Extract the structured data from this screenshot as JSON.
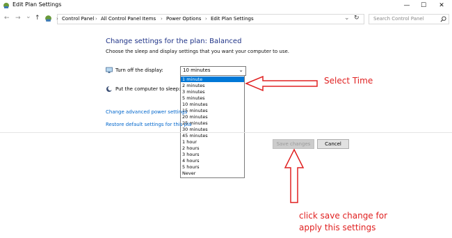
{
  "window": {
    "title": "Edit Plan Settings",
    "minimize_glyph": "—",
    "maximize_glyph": "☐",
    "close_glyph": "✕"
  },
  "nav": {
    "back_glyph": "←",
    "forward_glyph": "→",
    "recent_glyph": "⌄",
    "up_glyph": "↑",
    "refresh_glyph": "↻",
    "history_glyph": "⌄"
  },
  "breadcrumb": {
    "separator": "›",
    "items": [
      "Control Panel",
      "All Control Panel Items",
      "Power Options",
      "Edit Plan Settings"
    ]
  },
  "search": {
    "placeholder": "Search Control Panel",
    "icon": "search-icon"
  },
  "main": {
    "title": "Change settings for the plan: Balanced",
    "subtitle": "Choose the sleep and display settings that you want your computer to use.",
    "display_label": "Turn off the display:",
    "sleep_label": "Put the computer to sleep:",
    "display_value": "10 minutes",
    "options": [
      "1 minute",
      "2 minutes",
      "3 minutes",
      "5 minutes",
      "10 minutes",
      "15 minutes",
      "20 minutes",
      "25 minutes",
      "30 minutes",
      "45 minutes",
      "1 hour",
      "2 hours",
      "3 hours",
      "4 hours",
      "5 hours",
      "Never"
    ],
    "selected_option": "1 minute",
    "advanced_link": "Change advanced power settings",
    "restore_link": "Restore default settings for this pla",
    "save_button": "Save changes",
    "cancel_button": "Cancel"
  },
  "annotations": {
    "select_time": "Select Time",
    "save_hint_line1": "click save change for",
    "save_hint_line2": "apply this settings",
    "color": "#e02020"
  }
}
